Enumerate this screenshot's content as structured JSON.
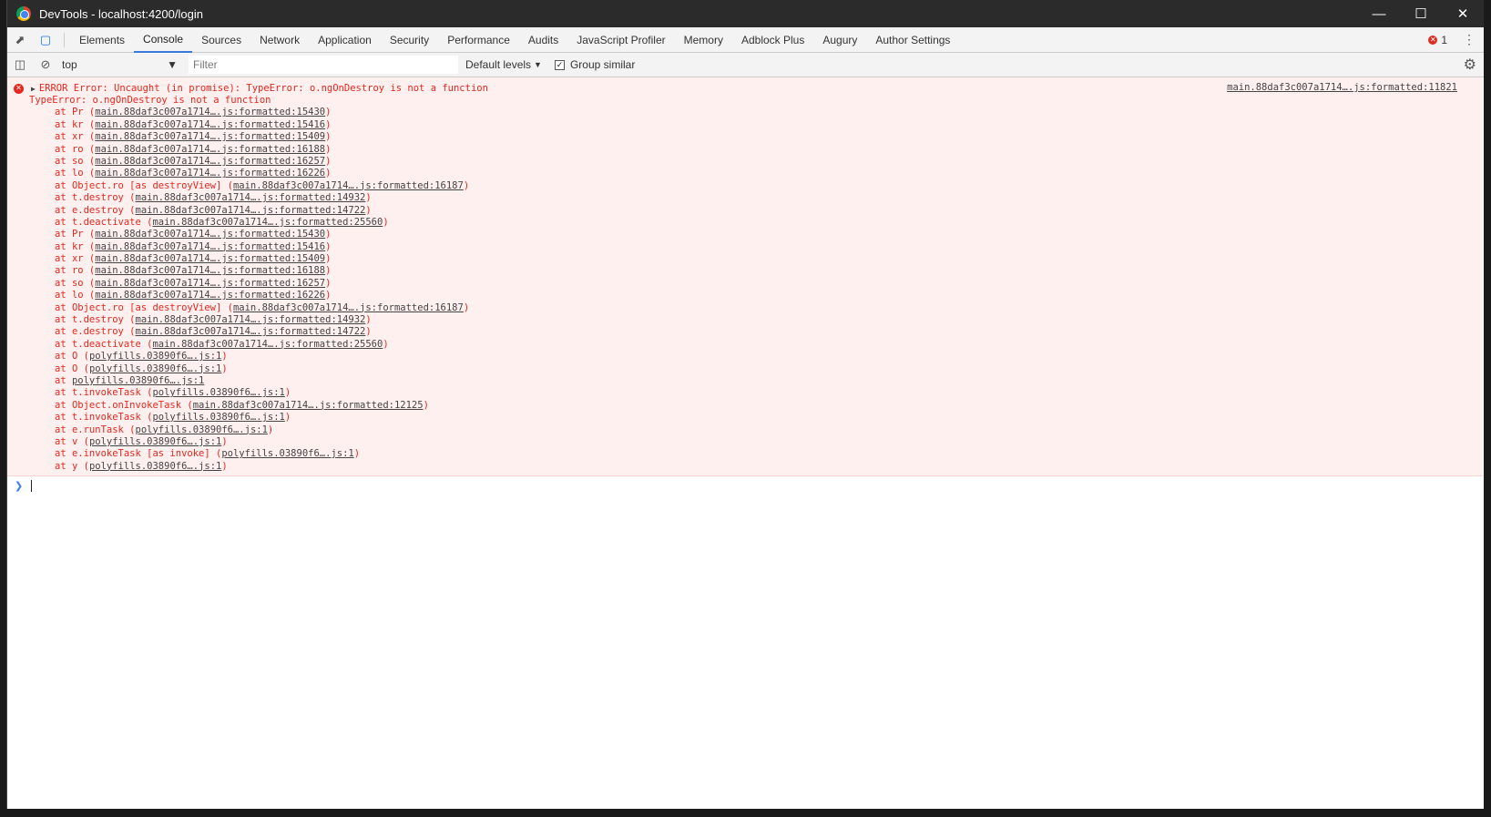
{
  "window": {
    "title": "DevTools - localhost:4200/login"
  },
  "tabs": [
    "Elements",
    "Console",
    "Sources",
    "Network",
    "Application",
    "Security",
    "Performance",
    "Audits",
    "JavaScript Profiler",
    "Memory",
    "Adblock Plus",
    "Augury",
    "Author Settings"
  ],
  "active_tab": "Console",
  "error_count": "1",
  "toolbar": {
    "context": "top",
    "filter_placeholder": "Filter",
    "levels": "Default levels",
    "group_similar": "Group similar"
  },
  "error": {
    "message": "ERROR Error: Uncaught (in promise): TypeError: o.ngOnDestroy is not a function",
    "source": "main.88daf3c007a1714….js:formatted:11821",
    "first_line": "TypeError: o.ngOnDestroy is not a function",
    "stack": [
      {
        "text": "at Pr (",
        "link": "main.88daf3c007a1714….js:formatted:15430",
        "end": ")"
      },
      {
        "text": "at kr (",
        "link": "main.88daf3c007a1714….js:formatted:15416",
        "end": ")"
      },
      {
        "text": "at xr (",
        "link": "main.88daf3c007a1714….js:formatted:15409",
        "end": ")"
      },
      {
        "text": "at ro (",
        "link": "main.88daf3c007a1714….js:formatted:16188",
        "end": ")"
      },
      {
        "text": "at so (",
        "link": "main.88daf3c007a1714….js:formatted:16257",
        "end": ")"
      },
      {
        "text": "at lo (",
        "link": "main.88daf3c007a1714….js:formatted:16226",
        "end": ")"
      },
      {
        "text": "at Object.ro [as destroyView] (",
        "link": "main.88daf3c007a1714….js:formatted:16187",
        "end": ")"
      },
      {
        "text": "at t.destroy (",
        "link": "main.88daf3c007a1714….js:formatted:14932",
        "end": ")"
      },
      {
        "text": "at e.destroy (",
        "link": "main.88daf3c007a1714….js:formatted:14722",
        "end": ")"
      },
      {
        "text": "at t.deactivate (",
        "link": "main.88daf3c007a1714….js:formatted:25560",
        "end": ")"
      },
      {
        "text": "at Pr (",
        "link": "main.88daf3c007a1714….js:formatted:15430",
        "end": ")"
      },
      {
        "text": "at kr (",
        "link": "main.88daf3c007a1714….js:formatted:15416",
        "end": ")"
      },
      {
        "text": "at xr (",
        "link": "main.88daf3c007a1714….js:formatted:15409",
        "end": ")"
      },
      {
        "text": "at ro (",
        "link": "main.88daf3c007a1714….js:formatted:16188",
        "end": ")"
      },
      {
        "text": "at so (",
        "link": "main.88daf3c007a1714….js:formatted:16257",
        "end": ")"
      },
      {
        "text": "at lo (",
        "link": "main.88daf3c007a1714….js:formatted:16226",
        "end": ")"
      },
      {
        "text": "at Object.ro [as destroyView] (",
        "link": "main.88daf3c007a1714….js:formatted:16187",
        "end": ")"
      },
      {
        "text": "at t.destroy (",
        "link": "main.88daf3c007a1714….js:formatted:14932",
        "end": ")"
      },
      {
        "text": "at e.destroy (",
        "link": "main.88daf3c007a1714….js:formatted:14722",
        "end": ")"
      },
      {
        "text": "at t.deactivate (",
        "link": "main.88daf3c007a1714….js:formatted:25560",
        "end": ")"
      },
      {
        "text": "at O (",
        "link": "polyfills.03890f6….js:1",
        "end": ")"
      },
      {
        "text": "at O (",
        "link": "polyfills.03890f6….js:1",
        "end": ")"
      },
      {
        "text": "at ",
        "link": "polyfills.03890f6….js:1",
        "end": ""
      },
      {
        "text": "at t.invokeTask (",
        "link": "polyfills.03890f6….js:1",
        "end": ")"
      },
      {
        "text": "at Object.onInvokeTask (",
        "link": "main.88daf3c007a1714….js:formatted:12125",
        "end": ")"
      },
      {
        "text": "at t.invokeTask (",
        "link": "polyfills.03890f6….js:1",
        "end": ")"
      },
      {
        "text": "at e.runTask (",
        "link": "polyfills.03890f6….js:1",
        "end": ")"
      },
      {
        "text": "at v (",
        "link": "polyfills.03890f6….js:1",
        "end": ")"
      },
      {
        "text": "at e.invokeTask [as invoke] (",
        "link": "polyfills.03890f6….js:1",
        "end": ")"
      },
      {
        "text": "at y (",
        "link": "polyfills.03890f6….js:1",
        "end": ")"
      }
    ]
  }
}
